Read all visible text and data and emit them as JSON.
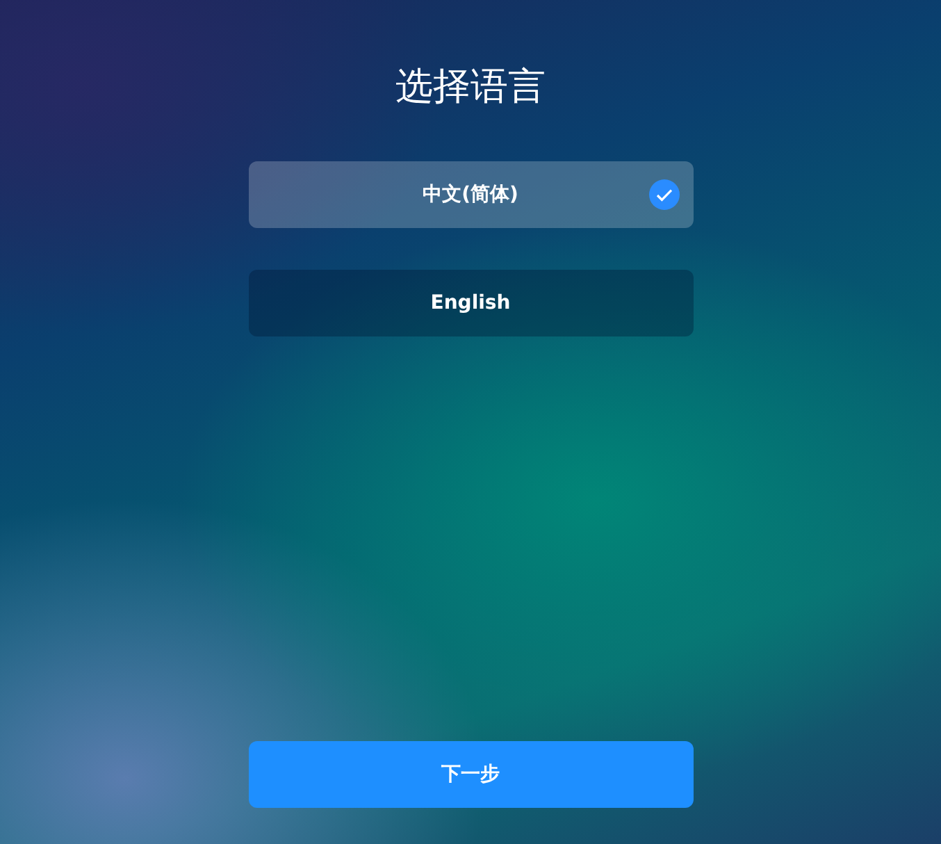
{
  "title": "选择语言",
  "languages": [
    {
      "label": "中文(简体)",
      "selected": true
    },
    {
      "label": "English",
      "selected": false
    }
  ],
  "next_button": "下一步"
}
